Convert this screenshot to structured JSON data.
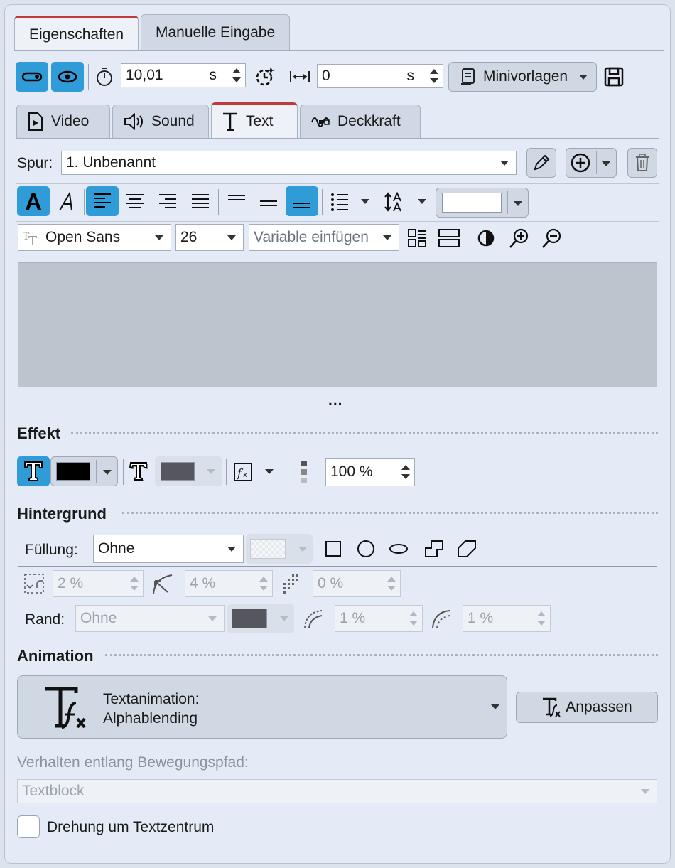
{
  "tabs_top": [
    {
      "label": "Eigenschaften",
      "active": true
    },
    {
      "label": "Manuelle Eingabe",
      "active": false
    }
  ],
  "timing": {
    "duration_value": "10,01",
    "duration_unit": "s",
    "offset_value": "0",
    "offset_unit": "s",
    "minivorlagen_label": "Minivorlagen"
  },
  "tabs_sub": [
    {
      "label": "Video"
    },
    {
      "label": "Sound"
    },
    {
      "label": "Text",
      "active": true
    },
    {
      "label": "Deckkraft"
    }
  ],
  "spur": {
    "label": "Spur:",
    "value": "1. Unbenannt"
  },
  "font": {
    "family": "Open Sans",
    "size": "26",
    "variable_placeholder": "Variable einfügen"
  },
  "text_area": {
    "more": "..."
  },
  "effekt": {
    "title": "Effekt",
    "opacity_value": "100 %"
  },
  "hintergrund": {
    "title": "Hintergrund",
    "fill_label": "Füllung:",
    "fill_value": "Ohne",
    "corner_value": "2 %",
    "radius_value": "4 %",
    "pattern_value": "0 %",
    "rand_label": "Rand:",
    "rand_value": "Ohne",
    "rand_width1": "1 %",
    "rand_width2": "1 %"
  },
  "animation": {
    "title": "Animation",
    "text_anim_label": "Textanimation:",
    "text_anim_value": "Alphablending",
    "adjust_label": "Anpassen",
    "path_label": "Verhalten entlang Bewegungspfad:",
    "path_value": "Textblock",
    "rotate_label": "Drehung um Textzentrum",
    "rotate_checked": false
  },
  "colors": {
    "accent": "#2f9bd7",
    "tab_active_line": "#c0393b",
    "text_preview_bg": "#bcc4ce",
    "effect_color": "#000000",
    "shadow_color": "#55565e",
    "border_color": "#55565e"
  }
}
